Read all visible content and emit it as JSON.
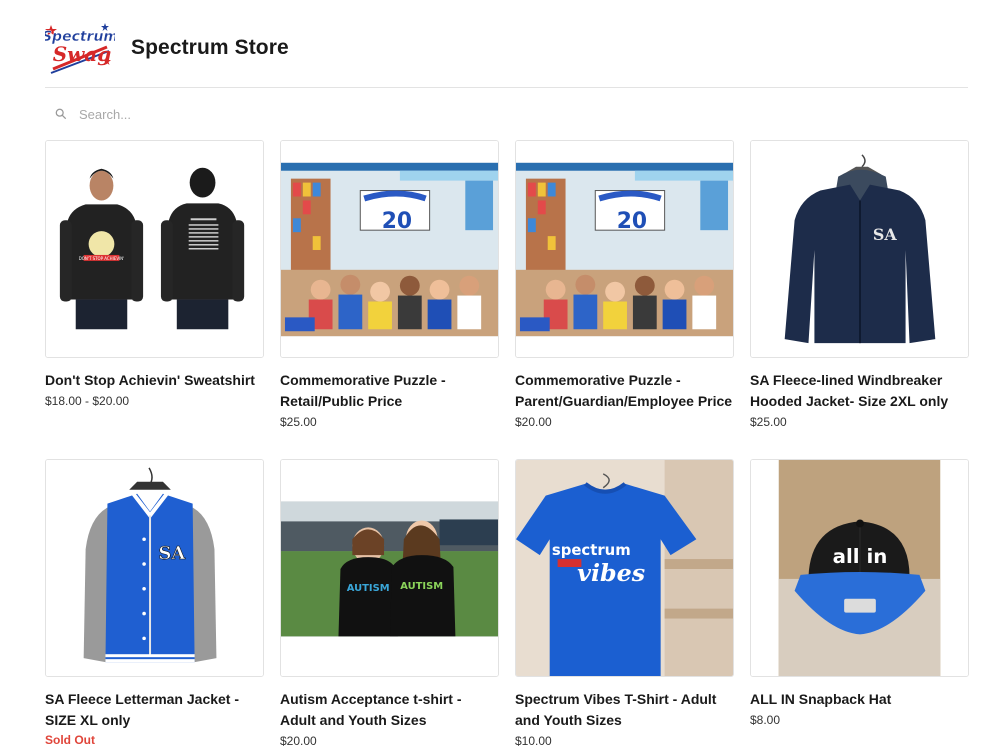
{
  "store": {
    "logo_line1": "Spectrum",
    "logo_line2": "Swag",
    "title": "Spectrum Store"
  },
  "search": {
    "placeholder": "Search..."
  },
  "colors": {
    "sold_out": "#e0453a",
    "border": "#e2e2e2",
    "logo_blue": "#1f3e9c",
    "logo_red": "#d62828"
  },
  "products": [
    {
      "name": "Don't Stop Achievin' Sweatshirt",
      "price": "$18.00 - $20.00"
    },
    {
      "name": "Commemorative Puzzle - Retail/Public Price",
      "price": "$25.00"
    },
    {
      "name": "Commemorative Puzzle - Parent/Guardian/Employee Price",
      "price": "$20.00"
    },
    {
      "name": "SA Fleece-lined Windbreaker Hooded Jacket- Size 2XL only",
      "price": "$25.00"
    },
    {
      "name": "SA Fleece Letterman Jacket - SIZE XL only",
      "status": "Sold Out"
    },
    {
      "name": "Autism Acceptance t-shirt - Adult and Youth Sizes",
      "price": "$20.00"
    },
    {
      "name": "Spectrum Vibes T-Shirt - Adult and Youth Sizes",
      "price": "$10.00"
    },
    {
      "name": "ALL IN Snapback Hat",
      "price": "$8.00"
    }
  ],
  "images": {
    "sweatshirt_print": "DON'T STOP ACHIEVIN'",
    "puzzle_number": "20",
    "jacket_letters": "SA",
    "hat_text": "all in",
    "tshirt_line1": "spectrum",
    "tshirt_line2": "vibes",
    "autism_shirt_text": "AUTISM"
  }
}
